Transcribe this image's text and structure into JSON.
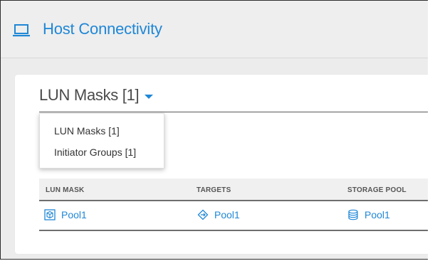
{
  "header": {
    "title": "Host Connectivity",
    "icon": "laptop-icon"
  },
  "card": {
    "title": "LUN Masks [1]",
    "dropdown": {
      "items": [
        {
          "label": "LUN Masks [1]"
        },
        {
          "label": "Initiator Groups [1]"
        }
      ]
    },
    "table": {
      "columns": [
        "LUN MASK",
        "TARGETS",
        "STORAGE POOL"
      ],
      "rows": [
        {
          "lun_mask": "Pool1",
          "targets": "Pool1",
          "storage_pool": "Pool1"
        }
      ]
    }
  },
  "colors": {
    "accent": "#1f87d6",
    "text": "#4a4a4a"
  }
}
